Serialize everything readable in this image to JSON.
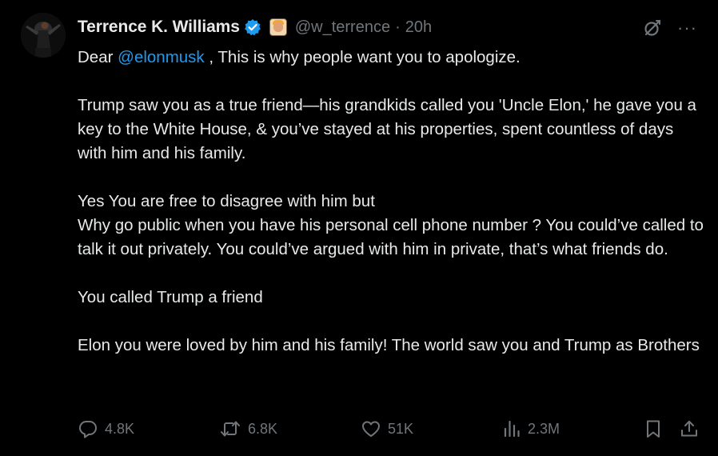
{
  "tweet": {
    "author": {
      "display_name": "Terrence K. Williams",
      "handle": "@w_terrence",
      "separator": "·",
      "time": "20h",
      "avatar_icon": "avatar-photo",
      "verified_icon": "verified-badge-icon",
      "affiliate_icon": "affiliate-badge-icon"
    },
    "top_actions": {
      "grok_icon": "grok-icon",
      "more_label": "···"
    },
    "body": {
      "line1_prefix": "Dear ",
      "line1_mention": "@elonmusk",
      "line1_suffix": " , This is why people want you to apologize.",
      "para2": "Trump saw you as a true friend—his grandkids called you 'Uncle Elon,' he gave you a key to the White House, & you’ve stayed at his properties, spent countless of days with him and his family.",
      "para3_line1": "Yes You are free to disagree with him but",
      "para3_line2": "Why go public when you have his personal cell phone number ? You could’ve called to talk it out privately. You could’ve argued with him in private, that’s what friends do.",
      "para4": "You called Trump a friend",
      "para5": "Elon you were loved by him and his family! The world saw you and Trump as Brothers"
    },
    "metrics": {
      "replies": "4.8K",
      "reposts": "6.8K",
      "likes": "51K",
      "views": "2.3M"
    },
    "colors": {
      "background": "#000000",
      "text": "#e7e9ea",
      "secondary": "#71767b",
      "link": "#1d9bf0",
      "verified": "#1d9bf0"
    }
  }
}
